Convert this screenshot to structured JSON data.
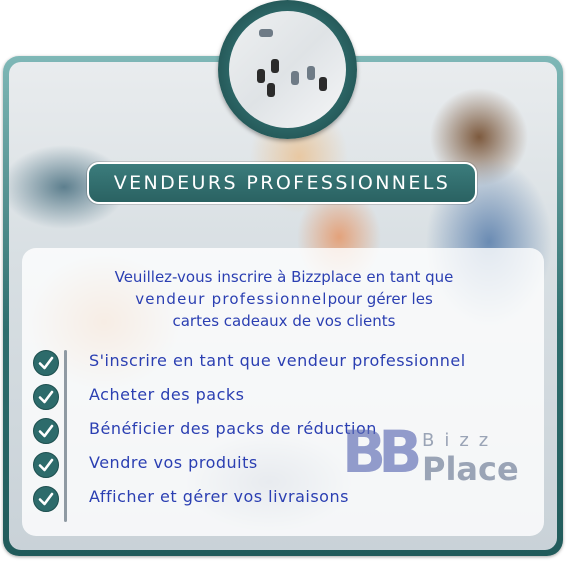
{
  "header": {
    "title": "VENDEURS PROFESSIONNELS"
  },
  "intro": {
    "line1": "Veuillez-vous inscrire à Bizzplace en tant que",
    "line2_emphasis": "vendeur professionnel",
    "line2_rest": "pour gérer les",
    "line3": "cartes cadeaux de vos clients"
  },
  "features": [
    "S'inscrire en tant que vendeur professionnel",
    "Acheter des packs",
    "Bénéficier des packs de réduction",
    "Vendre vos produits",
    "Afficher et gérer vos livraisons"
  ],
  "logo": {
    "mark": "BB",
    "top": "Bizz",
    "bottom": "Place"
  },
  "icons": {
    "check": "check-circle-icon",
    "avatar": "group-meeting-photo"
  },
  "colors": {
    "accent": "#2d6b6b",
    "text": "#2b3fb2"
  }
}
